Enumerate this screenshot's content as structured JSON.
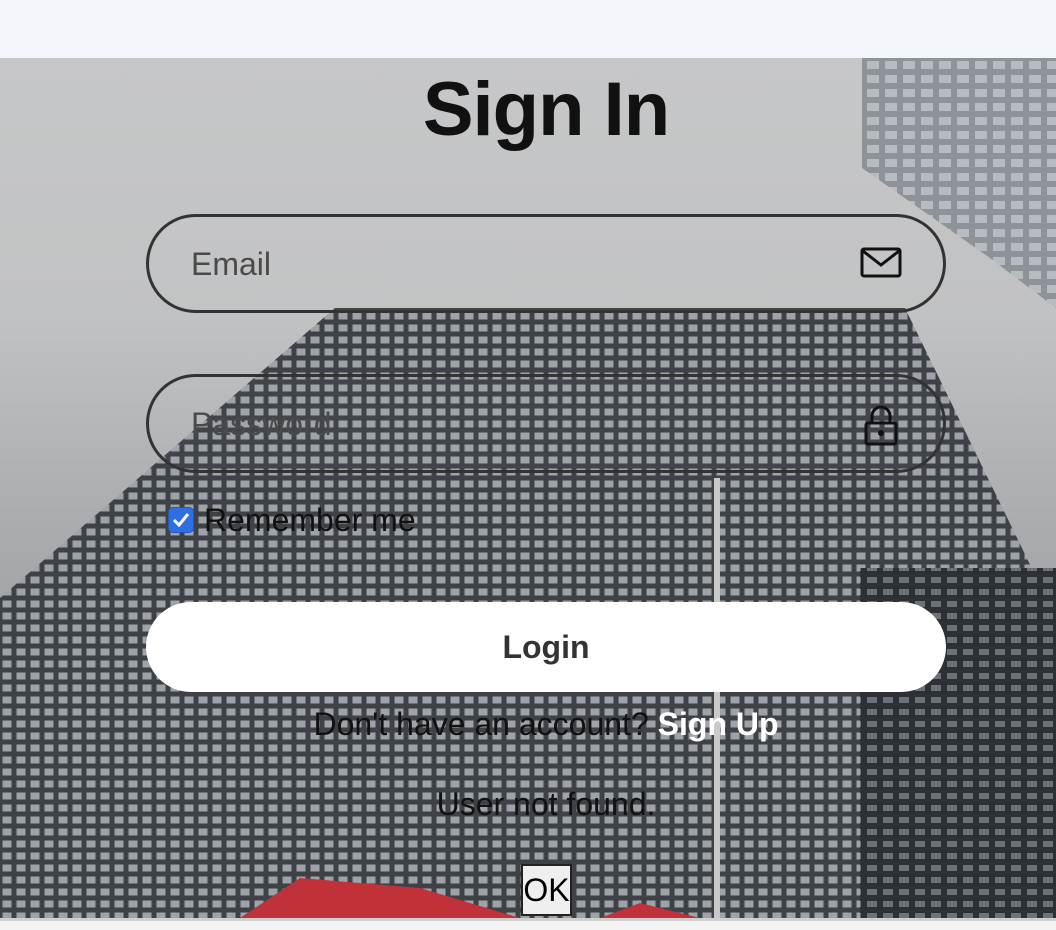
{
  "page": {
    "title": "Sign In"
  },
  "form": {
    "email": {
      "placeholder": "Email",
      "value": "",
      "icon": "mail-icon"
    },
    "password": {
      "placeholder": "Password",
      "value": "",
      "icon": "lock-icon"
    },
    "remember": {
      "label": "Remember me",
      "checked": true
    },
    "login_label": "Login",
    "signup_prompt": "Don't have an account?",
    "signup_link": "Sign Up"
  },
  "alert": {
    "message": "User not found.",
    "ok_label": "OK"
  },
  "colors": {
    "checkbox": "#2f6fe4",
    "login_bg": "#ffffff",
    "link": "#ffffff"
  }
}
